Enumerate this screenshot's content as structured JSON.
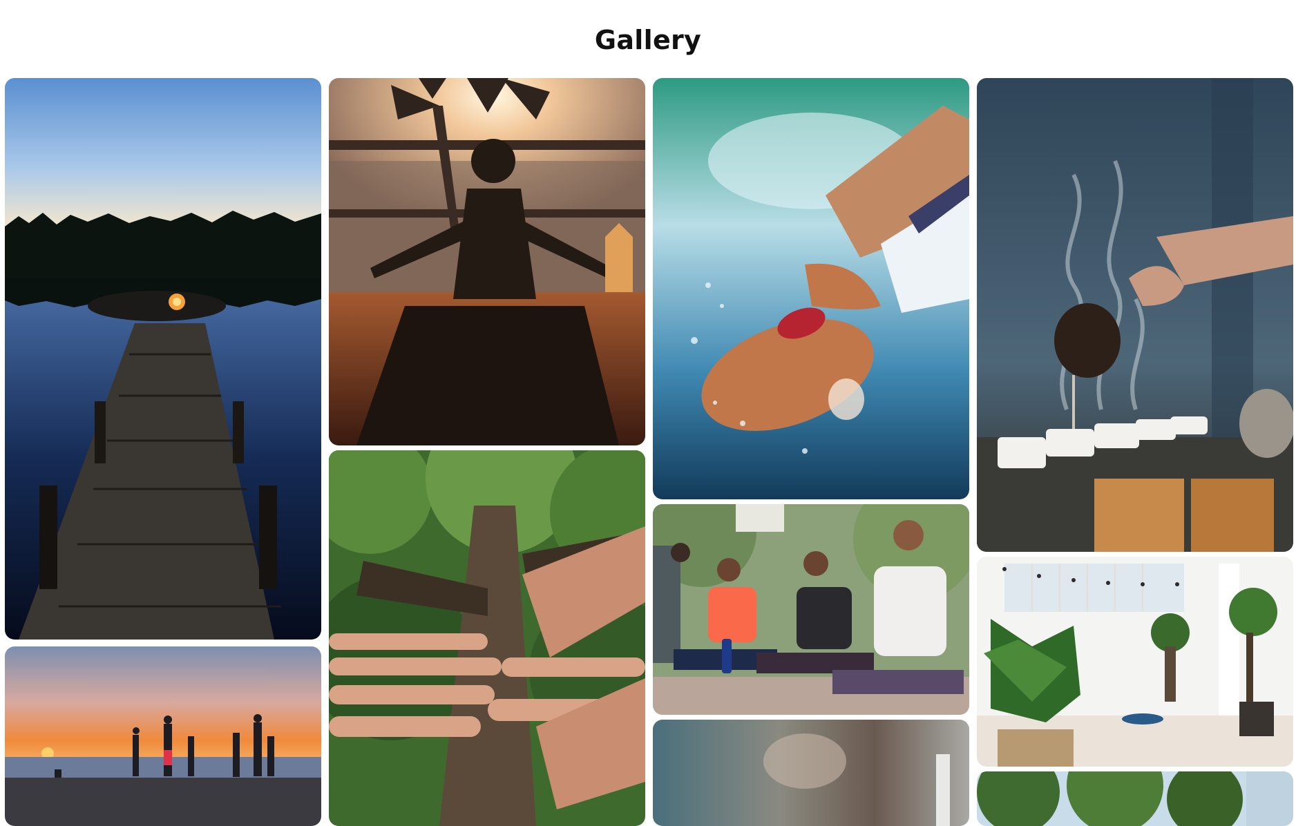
{
  "page": {
    "title": "Gallery"
  },
  "gallery": {
    "columns": [
      {
        "images": [
          "lake-dock-bonfire",
          "beach-sunset-yoga"
        ]
      },
      {
        "images": [
          "palm-meditation-sunset",
          "hands-on-tree-trunk"
        ]
      },
      {
        "images": [
          "woman-floating-water",
          "group-yoga-outdoors",
          "blurred-partial-image"
        ]
      },
      {
        "images": [
          "tea-pouring-steam",
          "bright-plant-room",
          "partial-tree-image"
        ]
      }
    ]
  }
}
